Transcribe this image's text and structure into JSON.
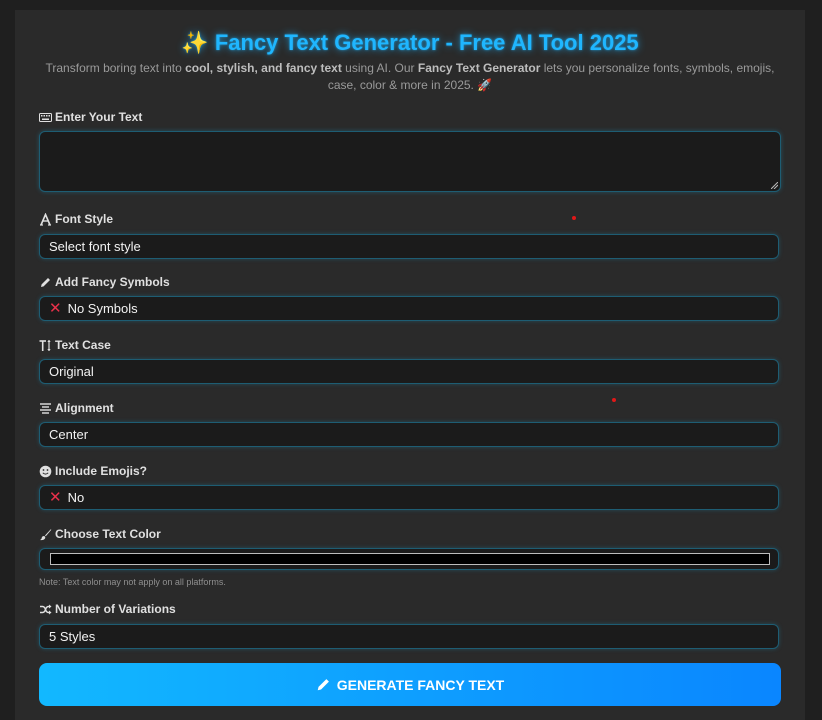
{
  "header": {
    "title_icon": "sparkles-icon",
    "title": "✨ Fancy Text Generator - Free AI Tool 2025",
    "subtitle_1": "Transform boring text into ",
    "subtitle_bold_1": "cool, stylish, and fancy text",
    "subtitle_2": " using AI. Our ",
    "subtitle_bold_2": "Fancy Text Generator",
    "subtitle_3": " lets you personalize fonts, symbols, emojis, case, color & more in 2025. 🚀"
  },
  "form": {
    "text": {
      "label": "Enter Your Text",
      "value": ""
    },
    "font_style": {
      "label": "Font Style",
      "value": "Select font style"
    },
    "symbols": {
      "label": "Add Fancy Symbols",
      "value": "No Symbols",
      "prefix_icon": "x-mark-icon"
    },
    "text_case": {
      "label": "Text Case",
      "value": "Original"
    },
    "alignment": {
      "label": "Alignment",
      "value": "Center"
    },
    "emojis": {
      "label": "Include Emojis?",
      "value": "No",
      "prefix_icon": "x-mark-icon"
    },
    "text_color": {
      "label": "Choose Text Color",
      "value": "#000000",
      "note": "Note: Text color may not apply on all platforms."
    },
    "variations": {
      "label": "Number of Variations",
      "value": "5 Styles"
    }
  },
  "generate_button": {
    "label": "GENERATE FANCY TEXT",
    "icon": "pencil-icon"
  },
  "colors": {
    "accent": "#1fb6ff",
    "button_start": "#12b8ff",
    "button_end": "#0a86ff",
    "field_border": "#1e5d73",
    "x_mark": "#e8314a"
  }
}
